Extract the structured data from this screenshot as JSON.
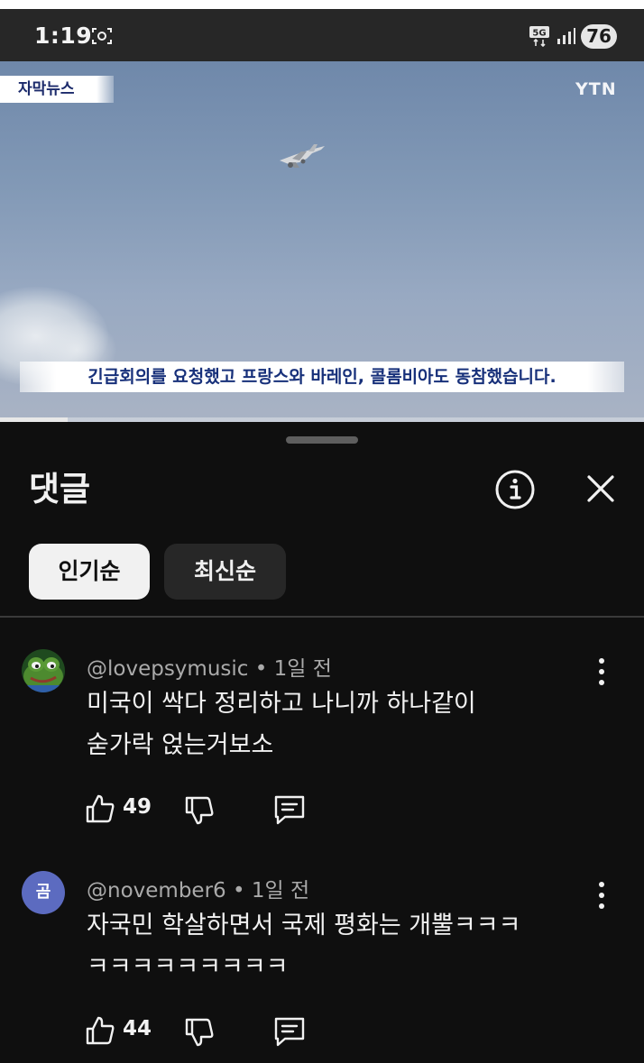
{
  "status_bar": {
    "time": "1:19",
    "network": "5G",
    "battery": "76",
    "icons": [
      "screen-record-icon",
      "5g-network-icon",
      "signal-icon",
      "battery-icon"
    ]
  },
  "video": {
    "tag": "자막뉴스",
    "channel_logo": "YTN",
    "subtitle": "긴급회의를 요청했고 프랑스와 바레인, 콜롬비아도 동참했습니다.",
    "progress": 0.105
  },
  "comments_panel": {
    "title": "댓글",
    "sort_chips": [
      {
        "label": "인기순",
        "active": true
      },
      {
        "label": "최신순",
        "active": false
      }
    ],
    "comments": [
      {
        "avatar": "frog-avatar",
        "author": "@lovepsymusic",
        "time": "• 1일 전",
        "lines": [
          "미국이 싹다 정리하고 나니까 하나같이",
          "숟가락 얹는거보소"
        ],
        "likes": "49"
      },
      {
        "avatar_letter": "곰",
        "author": "@november6",
        "time": "• 1일 전",
        "lines": [
          "자국민 학살하면서 국제 평화는 개뿔ㅋㅋㅋ",
          "ㅋㅋㅋㅋㅋㅋㅋㅋㅋ"
        ],
        "likes": "44"
      }
    ]
  },
  "colors": {
    "background": "#0f0f0f",
    "chip_active": "#f1f1f1",
    "chip_inactive": "#272727",
    "avatar_purple": "#5c6bc0",
    "subtitle_text": "#17307a"
  }
}
